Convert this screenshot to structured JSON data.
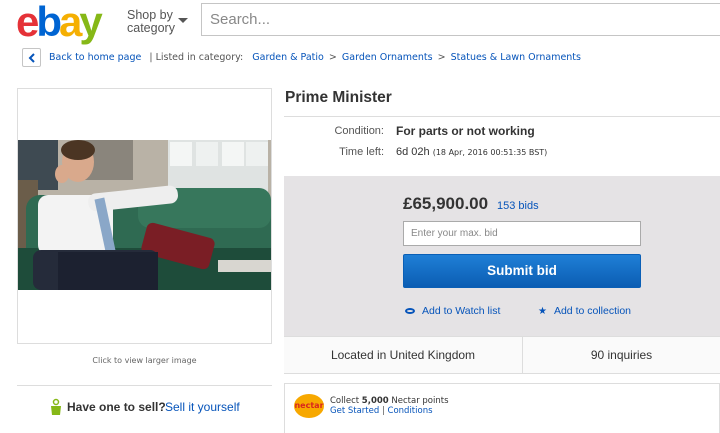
{
  "header": {
    "logo_letters": [
      "e",
      "b",
      "a",
      "y"
    ],
    "shop_by_line1": "Shop by",
    "shop_by_line2": "category",
    "search_placeholder": "Search..."
  },
  "breadcrumb": {
    "back_label": "Back to home page",
    "listed_label": "| Listed in category:",
    "items": [
      "Garden & Patio",
      "Garden Ornaments",
      "Statues & Lawn Ornaments"
    ],
    "separator": ">"
  },
  "gallery": {
    "caption": "Click to view larger image"
  },
  "sell": {
    "prompt": "Have one to sell?",
    "link": "Sell it yourself"
  },
  "item": {
    "title": "Prime Minister",
    "condition_label": "Condition:",
    "condition_value": "For parts or not working",
    "time_left_label": "Time left:",
    "time_left_value": "6d 02h",
    "time_left_date": "(18 Apr, 2016  00:51:35 BST)"
  },
  "bidding": {
    "price": "£65,900.00",
    "bids": "153 bids",
    "input_placeholder": "Enter your max. bid",
    "submit_label": "Submit bid",
    "watch_label": "Add to Watch list",
    "collection_label": "Add to collection"
  },
  "info": {
    "location": "Located in United Kingdom",
    "inquiries": "90 inquiries"
  },
  "nectar": {
    "logo_text": "nectar",
    "collect_prefix": "Collect ",
    "collect_points": "5,000",
    "collect_suffix": " Nectar points",
    "get_started": "Get Started",
    "separator": "|",
    "conditions": "Conditions"
  },
  "colors": {
    "logo_e": "#e53238",
    "logo_b": "#0064d2",
    "logo_a": "#f5af02",
    "logo_y": "#86b817",
    "link_blue": "#0654ba",
    "button_blue": "#0b5db3",
    "bid_panel_bg": "#e5e3e5",
    "nectar_orange": "#f7a800"
  }
}
